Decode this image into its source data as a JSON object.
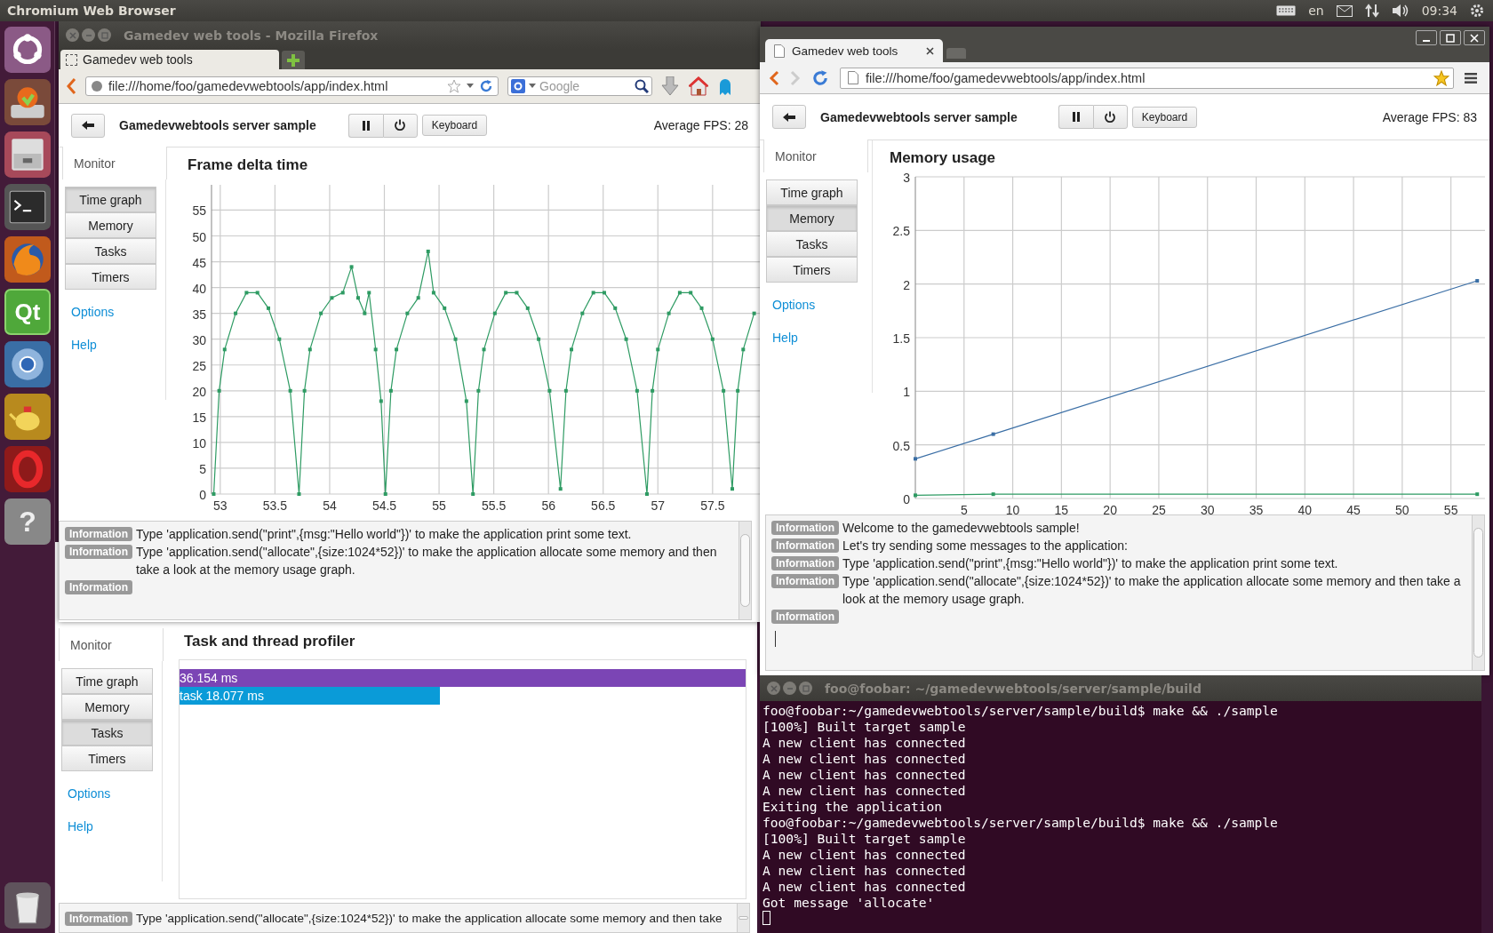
{
  "top_panel": {
    "title": "Chromium Web Browser",
    "language": "en",
    "clock": "09:34"
  },
  "launcher": [
    {
      "kind": "dash"
    },
    {
      "kind": "updater"
    },
    {
      "kind": "files"
    },
    {
      "kind": "terminal"
    },
    {
      "kind": "firefox"
    },
    {
      "kind": "qt",
      "text": "Qt"
    },
    {
      "kind": "chromium"
    },
    {
      "kind": "teapot"
    },
    {
      "kind": "opera"
    },
    {
      "kind": "help",
      "text": "?"
    },
    {
      "kind": "trash"
    }
  ],
  "profiler_window": {
    "sidebar": [
      {
        "label": "Time graph",
        "selected": false
      },
      {
        "label": "Memory",
        "selected": false
      },
      {
        "label": "Tasks",
        "selected": true
      },
      {
        "label": "Timers",
        "selected": false
      }
    ],
    "monitor_tab": "Monitor",
    "links": [
      "Options",
      "Help"
    ],
    "panel_title": "Task and thread profiler",
    "bars": [
      {
        "label": "36.154 ms",
        "level": 1,
        "color": "#7b45b5"
      },
      {
        "label": "task 18.077 ms",
        "level": 0.46,
        "color": "#0a9bd8"
      }
    ],
    "log": [
      {
        "badge": "Information",
        "text": "Type 'application.send(\"allocate\",{size:1024*52})' to make the application allocate some memory and then take"
      }
    ]
  },
  "firefox_window": {
    "title": "Gamedev web tools - Mozilla Firefox",
    "tab": "Gamedev web tools",
    "url": "file:///home/foo/gamedevwebtools/app/index.html",
    "search_placeholder": "Google",
    "page": {
      "header": {
        "title": "Gamedevwebtools server sample",
        "keyboard": "Keyboard",
        "fps": "Average FPS: 28"
      },
      "monitor_tab": "Monitor",
      "sidebar": [
        {
          "label": "Time graph",
          "selected": true
        },
        {
          "label": "Memory",
          "selected": false
        },
        {
          "label": "Tasks",
          "selected": false
        },
        {
          "label": "Timers",
          "selected": false
        }
      ],
      "links": [
        "Options",
        "Help"
      ],
      "panel": {
        "chart_data": {
          "type": "line",
          "grid": true,
          "title": "Frame delta time",
          "xlim": [
            52.92,
            57.94
          ],
          "ylim": [
            0,
            59.9
          ],
          "xticks": [
            53,
            53.5,
            54,
            54.5,
            55,
            55.5,
            56,
            56.5,
            57,
            57.5
          ],
          "yticks": [
            0,
            5,
            10,
            15,
            20,
            25,
            30,
            35,
            40,
            45,
            50,
            55
          ],
          "x": [
            52.94,
            52.99,
            53.04,
            53.14,
            53.24,
            53.34,
            53.44,
            53.54,
            53.64,
            53.72,
            53.77,
            53.82,
            53.92,
            54.02,
            54.12,
            54.2,
            54.26,
            54.32,
            54.36,
            54.42,
            54.47,
            54.51,
            54.56,
            54.61,
            54.71,
            54.81,
            54.9,
            54.95,
            55.05,
            55.15,
            55.25,
            55.31,
            55.36,
            55.41,
            55.51,
            55.61,
            55.71,
            55.81,
            55.91,
            56.01,
            56.11,
            56.16,
            56.21,
            56.31,
            56.41,
            56.51,
            56.61,
            56.71,
            56.81,
            56.9,
            56.95,
            57.0,
            57.1,
            57.2,
            57.3,
            57.4,
            57.5,
            57.6,
            57.68,
            57.73,
            57.78,
            57.88
          ],
          "series": [
            {
              "color": "#2e9b63",
              "marker": "square",
              "values": [
                0,
                20,
                28,
                35,
                39,
                39,
                36,
                30,
                20,
                0,
                20,
                28,
                35,
                38,
                39,
                44,
                38,
                35,
                39,
                28,
                18,
                0,
                20,
                28,
                35,
                38,
                47,
                39,
                36,
                30,
                18,
                0,
                20,
                28,
                35,
                39,
                39,
                36,
                30,
                20,
                1,
                20,
                28,
                35,
                39,
                39,
                36,
                30,
                20,
                0,
                20,
                28,
                35,
                39,
                39,
                36,
                30,
                20,
                1,
                20,
                28,
                35
              ]
            }
          ]
        }
      },
      "log": [
        {
          "badge": "Information",
          "text": "Type 'application.send(\"print\",{msg:\"Hello world\"})' to make the application print some text."
        },
        {
          "badge": "Information",
          "text": "Type 'application.send(\"allocate\",{size:1024*52})' to make the application allocate some memory and then take a look at the memory usage graph."
        },
        {
          "badge": "Information"
        }
      ]
    }
  },
  "chromium_window": {
    "tab": "Gamedev web tools",
    "url": "file:///home/foo/gamedevwebtools/app/index.html",
    "page": {
      "header": {
        "title": "Gamedevwebtools server sample",
        "keyboard": "Keyboard",
        "fps": "Average FPS: 83"
      },
      "monitor_tab": "Monitor",
      "sidebar": [
        {
          "label": "Time graph",
          "selected": false
        },
        {
          "label": "Memory",
          "selected": true
        },
        {
          "label": "Tasks",
          "selected": false
        },
        {
          "label": "Timers",
          "selected": false
        }
      ],
      "links": [
        "Options",
        "Help"
      ],
      "panel": {
        "chart_data": {
          "type": "line",
          "grid": true,
          "title": "Memory usage",
          "xlim": [
            0,
            58.5
          ],
          "ylim": [
            0,
            3
          ],
          "xticks": [
            5,
            10,
            15,
            20,
            25,
            30,
            35,
            40,
            45,
            50,
            55
          ],
          "yticks": [
            0,
            0.5,
            1,
            1.5,
            2,
            2.5,
            3
          ],
          "x": [
            0,
            8,
            57.7
          ],
          "series": [
            {
              "color": "#3a6ea5",
              "marker": "square",
              "values": [
                0.37,
                0.6,
                2.03
              ]
            },
            {
              "color": "#2e9b63",
              "marker": "square",
              "values": [
                0.03,
                0.04,
                0.04
              ]
            }
          ]
        }
      },
      "log": [
        {
          "badge": "Information",
          "text": "Welcome to the gamedevwebtools sample!"
        },
        {
          "badge": "Information",
          "text": "Let's try sending some messages to the application:"
        },
        {
          "badge": "Information",
          "text": "Type 'application.send(\"print\",{msg:\"Hello world\"})' to make the application print some text."
        },
        {
          "badge": "Information",
          "text": "Type 'application.send(\"allocate\",{size:1024*52})' to make the application allocate some memory and then take a look at the memory usage graph."
        },
        {
          "badge": "Information"
        }
      ]
    }
  },
  "terminal_window": {
    "title": "foo@foobar: ~/gamedevwebtools/server/sample/build",
    "lines": [
      "foo@foobar:~/gamedevwebtools/server/sample/build$ make && ./sample",
      "[100%] Built target sample",
      "A new client has connected",
      "A new client has connected",
      "A new client has connected",
      "A new client has connected",
      "Exiting the application",
      "foo@foobar:~/gamedevwebtools/server/sample/build$ make && ./sample",
      "[100%] Built target sample",
      "A new client has connected",
      "A new client has connected",
      "A new client has connected",
      "Got message 'allocate'"
    ]
  }
}
